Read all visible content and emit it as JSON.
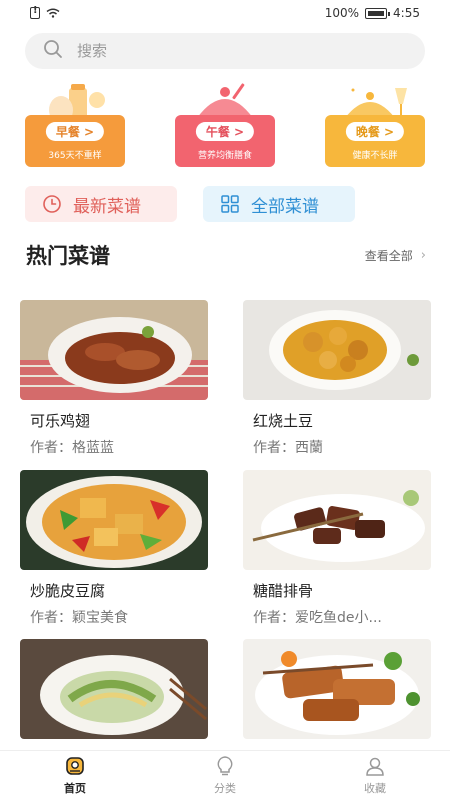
{
  "status_bar": {
    "battery": "100%",
    "time": "4:55"
  },
  "search": {
    "placeholder": "搜索"
  },
  "meals": [
    {
      "label": "早餐 >",
      "subtitle": "365天不重样",
      "color": "#f59b3c"
    },
    {
      "label": "午餐 >",
      "subtitle": "营养均衡膳食",
      "color": "#f2646f"
    },
    {
      "label": "晚餐 >",
      "subtitle": "健康不长胖",
      "color": "#f7b73c"
    }
  ],
  "quick_links": {
    "latest": "最新菜谱",
    "all": "全部菜谱"
  },
  "section": {
    "title": "热门菜谱",
    "view_all": "查看全部"
  },
  "recipes": [
    {
      "name": "可乐鸡翅",
      "author": "作者：格蓝蓝"
    },
    {
      "name": "红烧土豆",
      "author": "作者：西蘭"
    },
    {
      "name": "炒脆皮豆腐",
      "author": "作者：颖宝美食"
    },
    {
      "name": "糖醋排骨",
      "author": "作者：爱吃鱼de小..."
    },
    {
      "name": "",
      "author": ""
    },
    {
      "name": "",
      "author": ""
    }
  ],
  "tabs": [
    {
      "label": "首页"
    },
    {
      "label": "分类"
    },
    {
      "label": "收藏"
    }
  ]
}
